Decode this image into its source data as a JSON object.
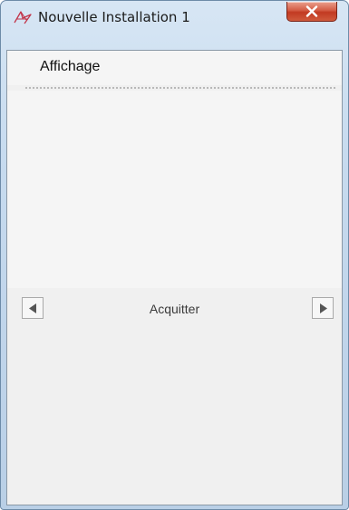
{
  "window": {
    "title": "Nouvelle Installation 1",
    "icon": "app-icon",
    "close_icon": "close-icon"
  },
  "menu": {
    "items": [
      {
        "label": "Affichage"
      }
    ]
  },
  "navigation": {
    "prev_icon": "left-arrow-icon",
    "label": "Acquitter",
    "next_icon": "right-arrow-icon"
  }
}
